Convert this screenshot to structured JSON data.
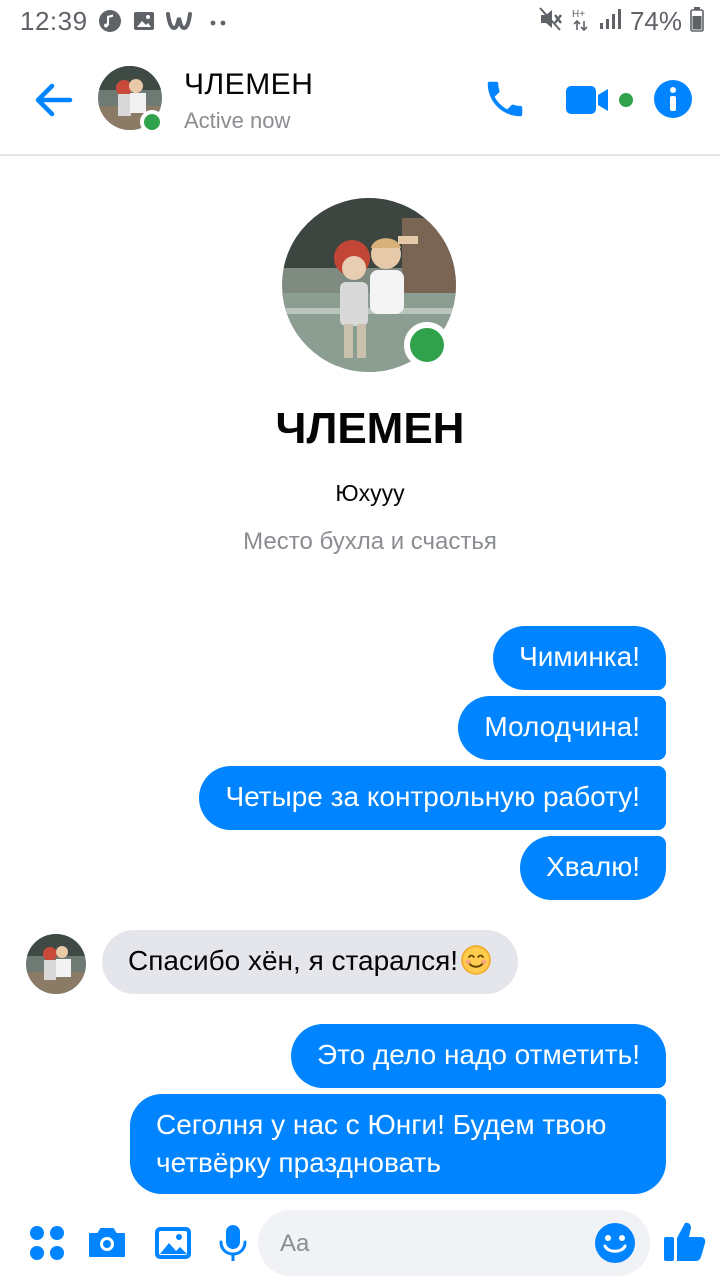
{
  "status_bar": {
    "time": "12:39",
    "battery": "74%",
    "left_icons": [
      "music-notification-icon",
      "gallery-notification-icon",
      "wattpad-notification-icon",
      "more-notifications-icon"
    ],
    "right_icons": [
      "mute-icon",
      "network-hplus-icon",
      "signal-icon",
      "battery-icon"
    ]
  },
  "header": {
    "contact_name": "ЧЛЕМЕН",
    "status": "Active now",
    "accent_color": "#0084ff",
    "online_color": "#31a24c"
  },
  "profile": {
    "name": "ЧЛЕМЕН",
    "subtitle": "Юхууу",
    "description": "Место бухла и счастья"
  },
  "messages": [
    {
      "direction": "outgoing",
      "text": "Чиминка!"
    },
    {
      "direction": "outgoing",
      "text": "Молодчина!"
    },
    {
      "direction": "outgoing",
      "text": "Четыре за контрольную работу!"
    },
    {
      "direction": "outgoing",
      "text": "Хвалю!"
    },
    {
      "direction": "incoming",
      "text": "Спасибо хён, я старался!",
      "emoji": "smiling-face-emoji"
    },
    {
      "direction": "outgoing",
      "text": "Это дело надо отметить!"
    },
    {
      "direction": "outgoing",
      "text": "Сеголня у нас с Юнги! Будем твою четвёрку праздновать"
    }
  ],
  "composer": {
    "placeholder": "Aa",
    "icons": [
      "apps-icon",
      "camera-icon",
      "gallery-icon",
      "microphone-icon",
      "emoji-icon",
      "thumbs-up-icon"
    ]
  }
}
